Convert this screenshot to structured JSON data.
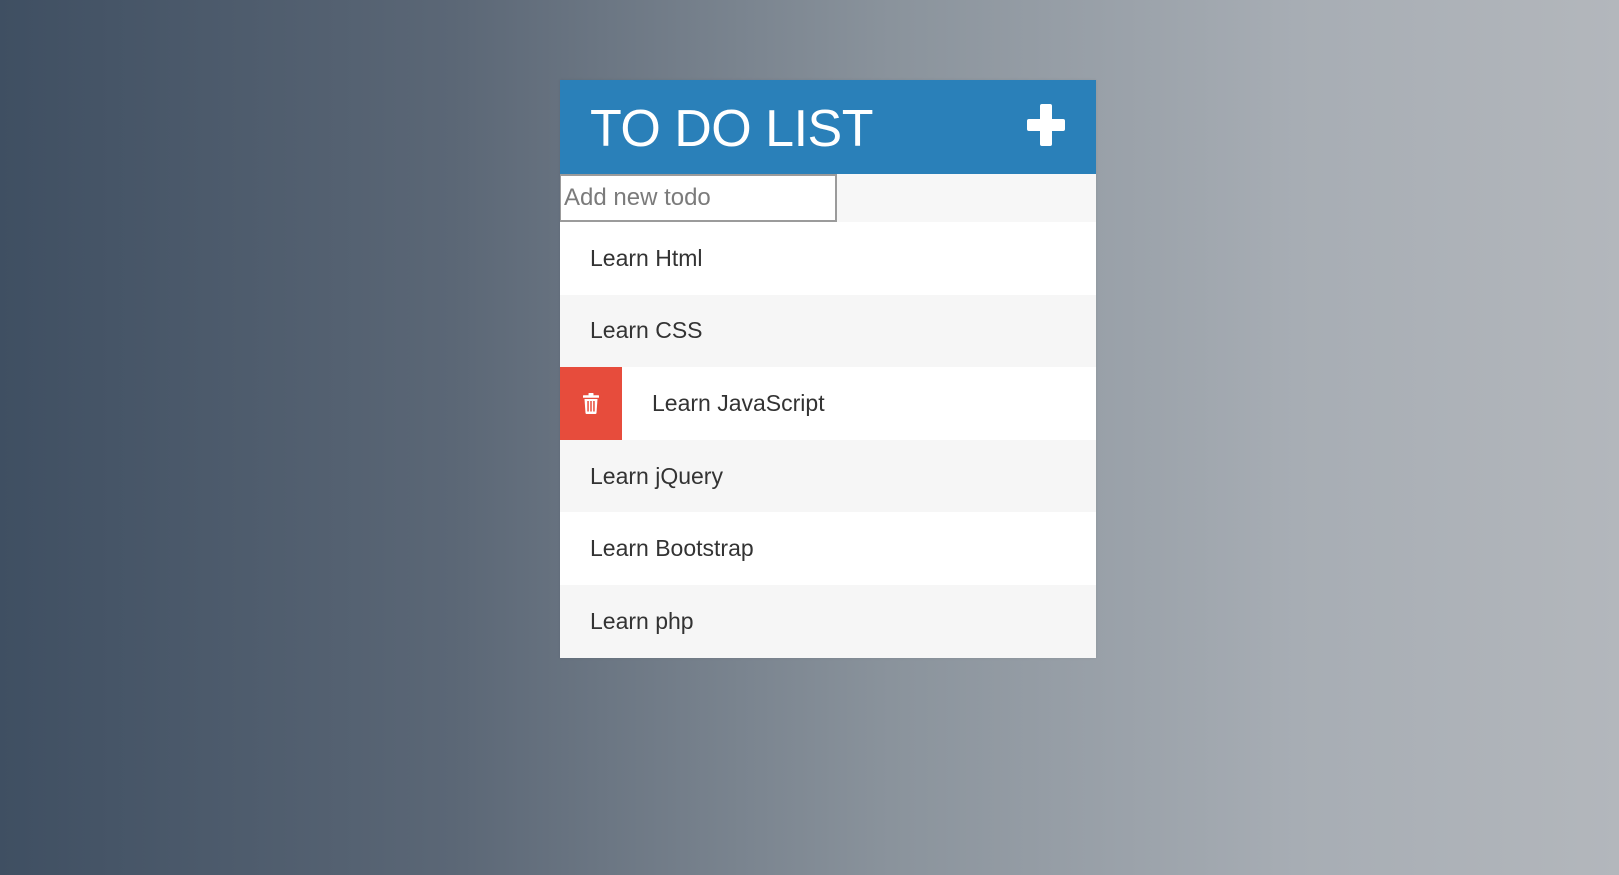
{
  "header": {
    "title": "TO DO LIST",
    "add_icon": "plus-icon"
  },
  "new_todo": {
    "placeholder": "Add new todo",
    "value": ""
  },
  "todos": [
    {
      "text": "Learn Html"
    },
    {
      "text": "Learn CSS"
    },
    {
      "text": "Learn JavaScript",
      "delete_icon": "trash-icon",
      "hovered": true
    },
    {
      "text": "Learn jQuery"
    },
    {
      "text": "Learn Bootstrap"
    },
    {
      "text": "Learn php"
    }
  ],
  "colors": {
    "header_bg": "#2a80b9",
    "delete_bg": "#e74c3c",
    "row_white": "#ffffff",
    "row_gray": "#f6f6f6"
  }
}
